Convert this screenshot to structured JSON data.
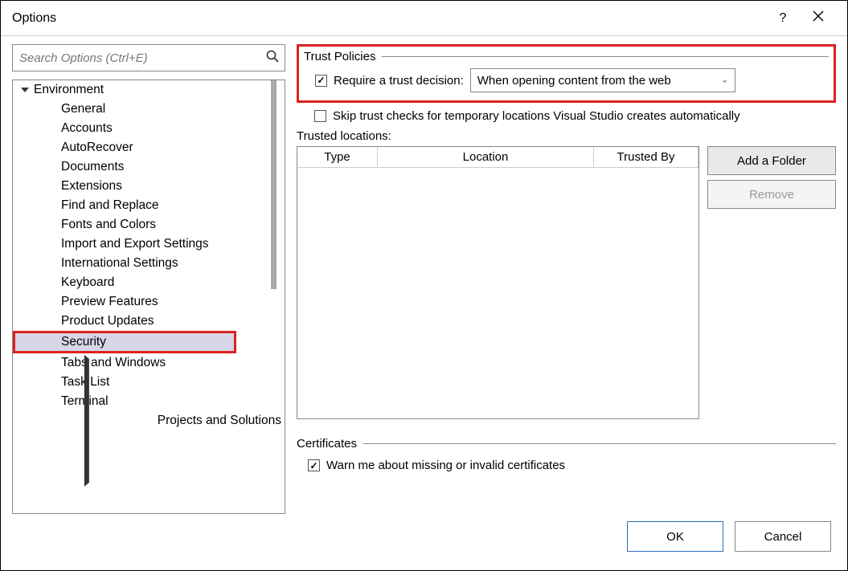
{
  "window": {
    "title": "Options"
  },
  "search": {
    "placeholder": "Search Options (Ctrl+E)"
  },
  "tree": {
    "cat1": "Environment",
    "items": [
      "General",
      "Accounts",
      "AutoRecover",
      "Documents",
      "Extensions",
      "Find and Replace",
      "Fonts and Colors",
      "Import and Export Settings",
      "International Settings",
      "Keyboard",
      "Preview Features",
      "Product Updates",
      "Security",
      "Tabs and Windows",
      "Task List",
      "Terminal"
    ],
    "cat2": "Projects and Solutions"
  },
  "trust": {
    "group": "Trust Policies",
    "requireLabel": "Require a trust decision:",
    "dropdown": "When opening content from the web",
    "skipLabel": "Skip trust checks for temporary locations Visual Studio creates automatically",
    "trustedLocations": "Trusted locations:",
    "thType": "Type",
    "thLocation": "Location",
    "thTrustedBy": "Trusted By",
    "addFolder": "Add a Folder",
    "remove": "Remove"
  },
  "certs": {
    "group": "Certificates",
    "warn": "Warn me about missing or invalid certificates"
  },
  "footer": {
    "ok": "OK",
    "cancel": "Cancel"
  }
}
